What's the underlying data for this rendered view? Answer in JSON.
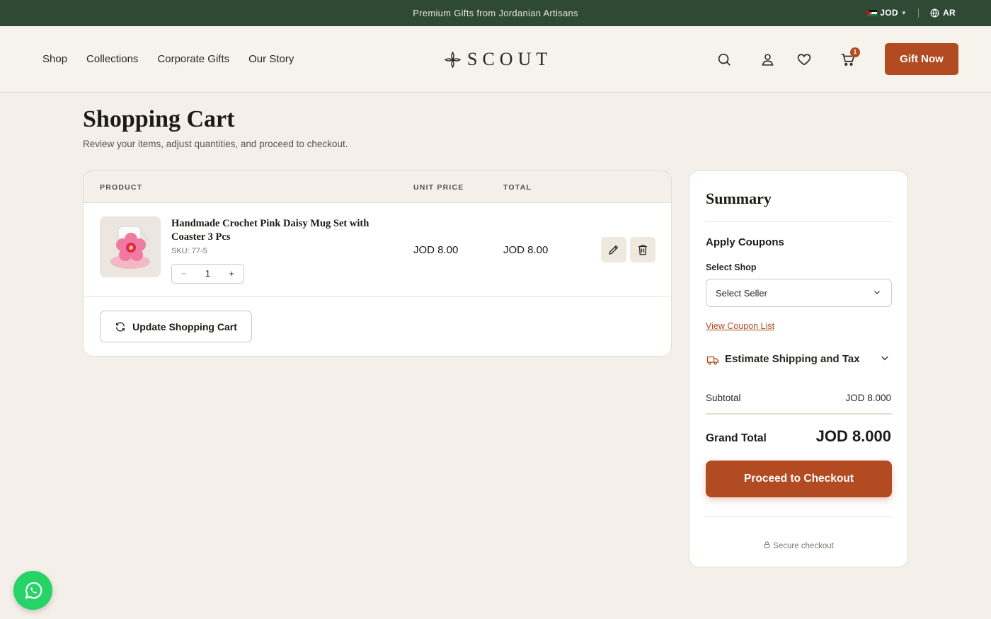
{
  "announcement": {
    "message": "Premium Gifts from Jordanian Artisans",
    "currency": "JOD",
    "language": "AR"
  },
  "header": {
    "nav": [
      "Shop",
      "Collections",
      "Corporate Gifts",
      "Our Story"
    ],
    "logo_text": "SCOUT",
    "icons": [
      "search-icon",
      "account-icon",
      "heart-icon",
      "cart-icon"
    ],
    "cart_count": "1",
    "cta_label": "Gift Now"
  },
  "page": {
    "title": "Shopping Cart",
    "subtitle": "Review your items, adjust quantities, and proceed to checkout."
  },
  "cart": {
    "columns": {
      "product": "PRODUCT",
      "unit_price": "UNIT PRICE",
      "total": "TOTAL"
    },
    "items": [
      {
        "name": "Handmade Crochet Pink Daisy Mug Set with Coaster 3 Pcs",
        "sku": "SKU: 77-5",
        "quantity": "1",
        "unit_price": "JOD 8.00",
        "total": "JOD 8.00"
      }
    ],
    "qty_minus": "−",
    "qty_plus": "+",
    "update_label": "Update Shopping Cart"
  },
  "summary": {
    "title": "Summary",
    "coupons_heading": "Apply Coupons",
    "select_shop_label": "Select Shop",
    "select_value": "Select Seller",
    "coupon_link": "View Coupon List",
    "shipping_label": "Estimate Shipping and Tax",
    "subtotal_label": "Subtotal",
    "subtotal_value": "JOD 8.000",
    "grand_total_label": "Grand Total",
    "grand_total_value": "JOD 8.000",
    "checkout_label": "Proceed to Checkout",
    "secure_label": "Secure checkout"
  },
  "colors": {
    "topbar": "#2e4a35",
    "accent": "#b24a22",
    "background": "#f4efe8",
    "whatsapp": "#25d366"
  }
}
